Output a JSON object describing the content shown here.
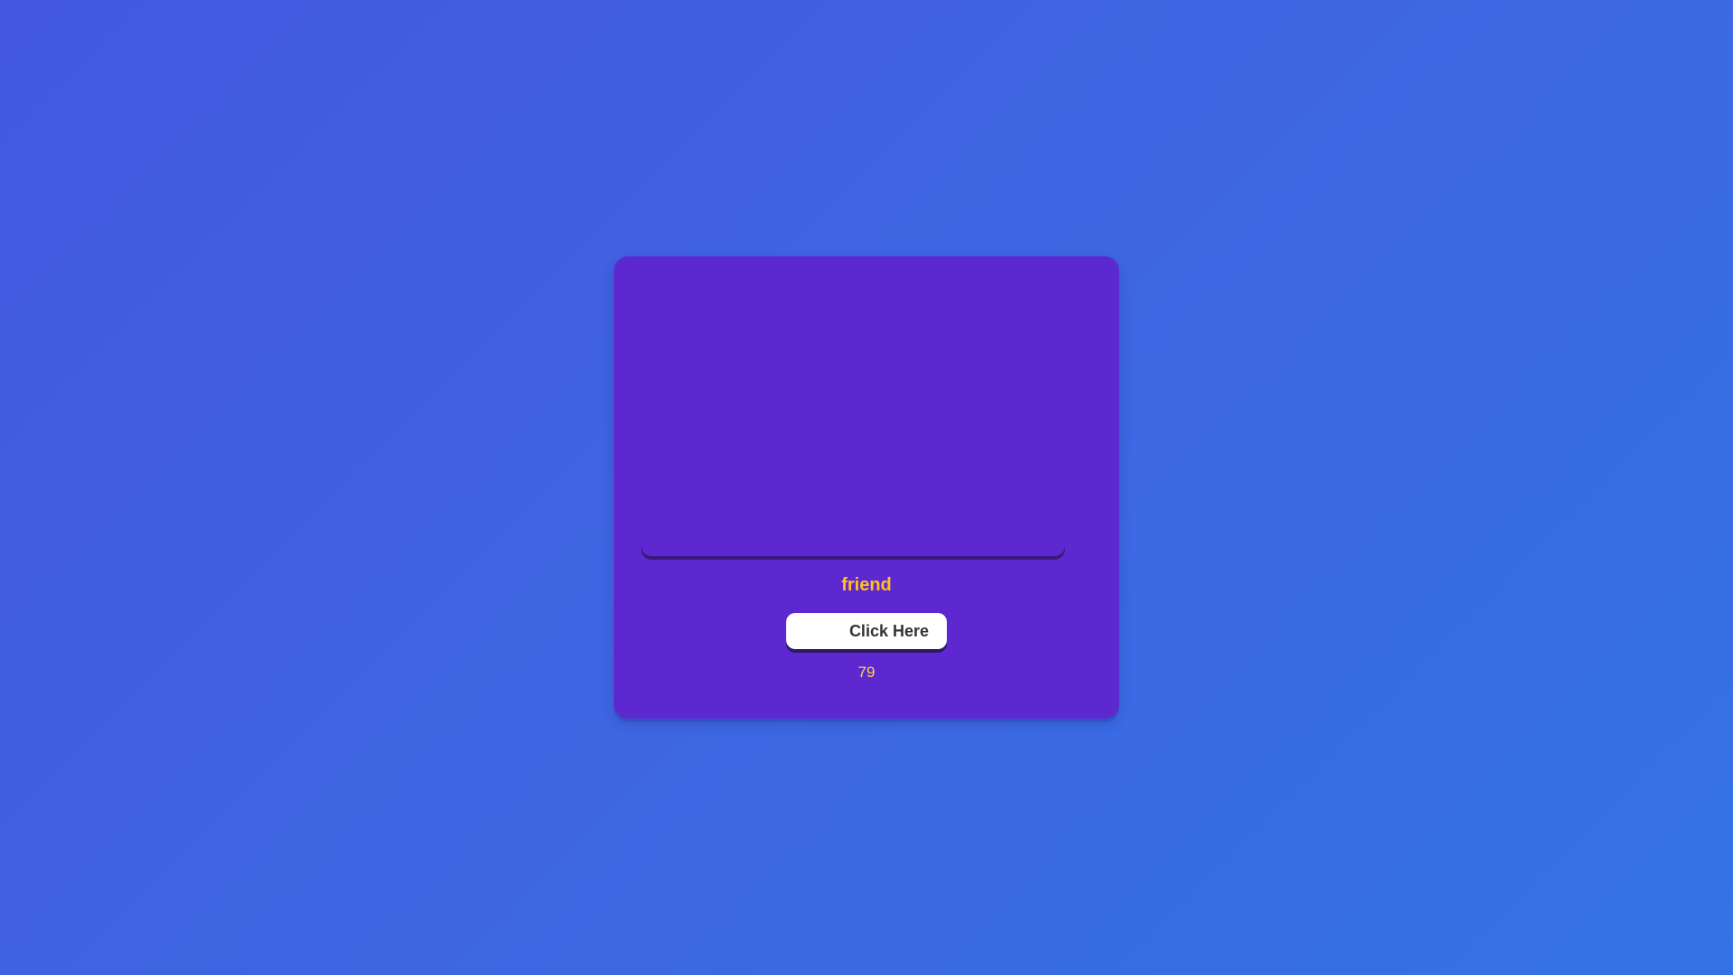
{
  "card": {
    "word": "friend",
    "button_label": "Click Here",
    "counter": "79"
  },
  "colors": {
    "background": "#3e66e3",
    "card": "#5e28d1",
    "accent_text": "#ffc21a",
    "button": "#ffffff"
  }
}
